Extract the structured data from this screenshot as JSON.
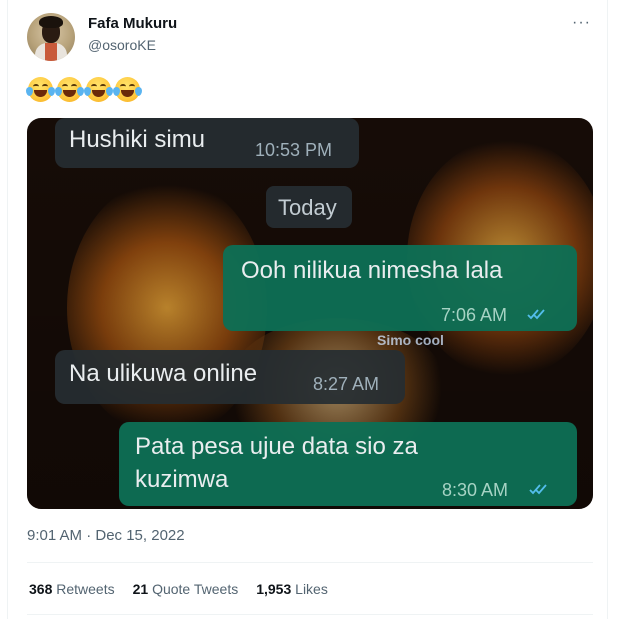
{
  "author": {
    "display_name": "Fafa Mukuru",
    "handle": "@osoroKE",
    "avatar_icon": "profile-photo"
  },
  "tweet": {
    "text_emojis": "😂😂😂😂",
    "emoji_name": "face-with-tears-of-joy-icon",
    "timestamp": "9:01 AM · Dec 15, 2022"
  },
  "more_menu": {
    "label": "···"
  },
  "screenshot": {
    "messages": [
      {
        "direction": "incoming",
        "text": "Hushiki simu",
        "time": "10:53 PM"
      },
      {
        "direction": "divider",
        "text": "Today"
      },
      {
        "direction": "outgoing",
        "text": "Ooh nilikua nimesha lala",
        "time": "7:06 AM",
        "ticks": "read"
      },
      {
        "direction": "incoming",
        "text": "Na ulikuwa online",
        "time": "8:27 AM"
      },
      {
        "direction": "outgoing",
        "text": "Pata pesa ujue data sio za kuzimwa",
        "time": "8:30 AM",
        "ticks": "read"
      }
    ],
    "watermark": "Simo cool",
    "colors": {
      "incoming": "#262d31",
      "outgoing": "#0e6e54",
      "read_ticks": "#53bdeb"
    }
  },
  "stats": {
    "retweets_count": "368",
    "retweets_label": "Retweets",
    "quotes_count": "21",
    "quotes_label": "Quote Tweets",
    "likes_count": "1,953",
    "likes_label": "Likes"
  },
  "colors": {
    "secondary_text": "#536471",
    "primary_text": "#0f1419",
    "divider": "#eff3f4"
  }
}
